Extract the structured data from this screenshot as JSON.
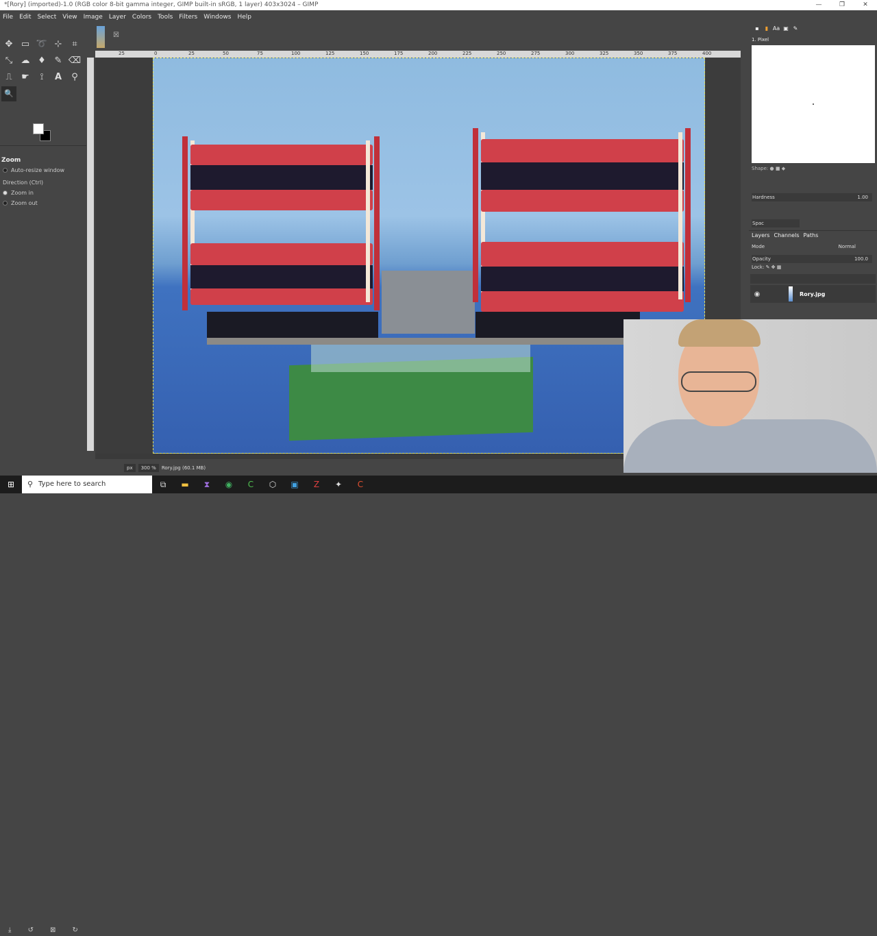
{
  "window": {
    "title": "*[Rory] (imported)-1.0 (RGB color 8-bit gamma integer, GIMP built-in sRGB, 1 layer) 403x3024 – GIMP",
    "controls": [
      "—",
      "❐",
      "✕"
    ]
  },
  "menu": [
    "File",
    "Edit",
    "Select",
    "View",
    "Image",
    "Layer",
    "Colors",
    "Tools",
    "Filters",
    "Windows",
    "Help"
  ],
  "toolbox": {
    "tools": [
      {
        "icon": "move-icon",
        "glyph": "✥"
      },
      {
        "icon": "rect-select-icon",
        "glyph": "▭"
      },
      {
        "icon": "lasso-icon",
        "glyph": "➰"
      },
      {
        "icon": "fuzzy-select-icon",
        "glyph": "⊹"
      },
      {
        "icon": "crop-icon",
        "glyph": "⌗"
      },
      {
        "icon": "transform-icon",
        "glyph": "⤡"
      },
      {
        "icon": "warp-icon",
        "glyph": "☁"
      },
      {
        "icon": "bucket-fill-icon",
        "glyph": "♦"
      },
      {
        "icon": "paintbrush-icon",
        "glyph": "✎"
      },
      {
        "icon": "eraser-icon",
        "glyph": "⌫"
      },
      {
        "icon": "clone-icon",
        "glyph": "⎍"
      },
      {
        "icon": "smudge-icon",
        "glyph": "☛"
      },
      {
        "icon": "paths-icon",
        "glyph": "⟟"
      },
      {
        "icon": "text-icon",
        "glyph": "A"
      },
      {
        "icon": "color-picker-icon",
        "glyph": "⚲"
      },
      {
        "icon": "zoom-icon",
        "glyph": "🔍"
      }
    ],
    "options_title": "Zoom",
    "auto_resize": "Auto-resize window",
    "direction_label": "Direction  (Ctrl)",
    "zoom_in": "Zoom in",
    "zoom_out": "Zoom out"
  },
  "canvas": {
    "ruler_ticks": [
      "25",
      "0",
      "25",
      "50",
      "75",
      "100",
      "125",
      "150",
      "175",
      "200",
      "225",
      "250",
      "275",
      "300",
      "325",
      "350",
      "375",
      "400"
    ]
  },
  "status": {
    "unit": "px",
    "zoom": "300 %",
    "filename": "Rory.jpg (60.1 MB)"
  },
  "right_panel": {
    "brush_name": "1. Pixel",
    "shape_label": "Shape:",
    "hardness_label": "Hardness",
    "hardness_value": "1.00",
    "spacing_label": "Spac",
    "tabs": [
      "Layers",
      "Channels",
      "Paths"
    ],
    "mode_label": "Mode",
    "mode_value": "Normal",
    "opacity_label": "Opacity",
    "opacity_value": "100.0",
    "lock_label": "Lock:",
    "layer_name": "Rory.jpg"
  },
  "taskbar": {
    "search_placeholder": "Type here to search",
    "apps": [
      "task-view-icon",
      "file-explorer-icon",
      "visual-studio-icon",
      "chrome-icon",
      "camtasia-icon",
      "unity-icon",
      "terminal-icon",
      "filezilla-icon",
      "gimp-icon",
      "recorder-icon"
    ]
  }
}
